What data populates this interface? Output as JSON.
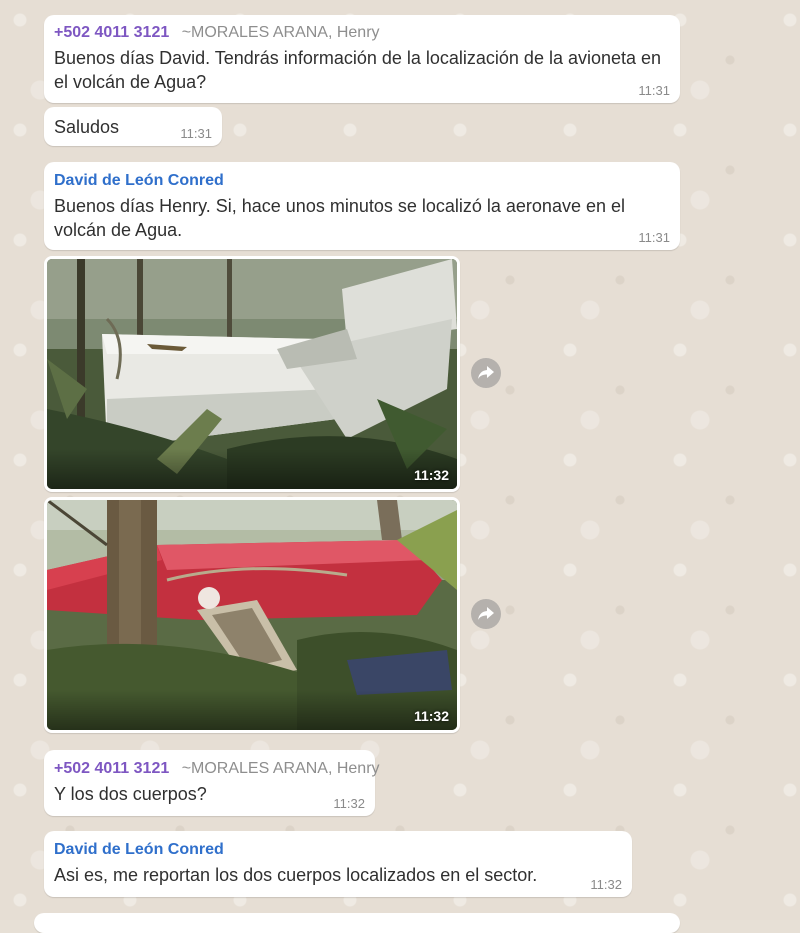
{
  "messages": {
    "m1": {
      "phone": "+502 4011 3121",
      "alias": "~MORALES ARANA, Henry",
      "text": "Buenos días David. Tendrás información de la localización de la avioneta en el volcán de Agua?",
      "time": "11:31"
    },
    "m2": {
      "text": "Saludos",
      "time": "11:31"
    },
    "m3": {
      "sender": "David de León Conred",
      "text": "Buenos días Henry. Si, hace unos minutos se localizó la aeronave en el volcán de Agua.",
      "time": "11:31"
    },
    "photo1": {
      "time": "11:32"
    },
    "photo2": {
      "time": "11:32"
    },
    "m4": {
      "phone": "+502 4011 3121",
      "alias": "~MORALES ARANA, Henry",
      "text": "Y los dos cuerpos?",
      "time": "11:32"
    },
    "m5": {
      "sender": "David de León Conred",
      "text": "Asi es, me reportan los dos cuerpos localizados en el sector.",
      "time": "11:32"
    }
  },
  "icons": {
    "forward": "forward-arrow-icon"
  },
  "colors": {
    "phone": "#7e57c2",
    "alias": "#8e8e8e",
    "david": "#2f6fcb",
    "wallpaper": "#e6ded4",
    "bubble": "#ffffff"
  }
}
